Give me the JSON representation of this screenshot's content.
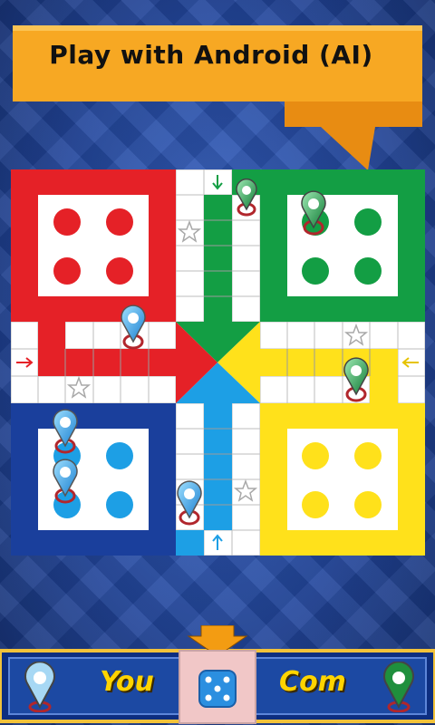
{
  "banner": {
    "title": "Play with Android (AI)"
  },
  "bottom_bar": {
    "player_label": "You",
    "opponent_label": "Com"
  },
  "colors": {
    "red": "#e52127",
    "green": "#139e44",
    "yellow": "#ffe11b",
    "blue": "#1d9fe5",
    "banner": "#f6a41c",
    "bar": "#1c49a3",
    "label": "#ffd400"
  },
  "icons": [
    "arrow-down-icon",
    "arrow-right-icon",
    "arrow-left-icon",
    "arrow-up-icon",
    "star-icon",
    "dice-icon",
    "pawn-icon"
  ]
}
